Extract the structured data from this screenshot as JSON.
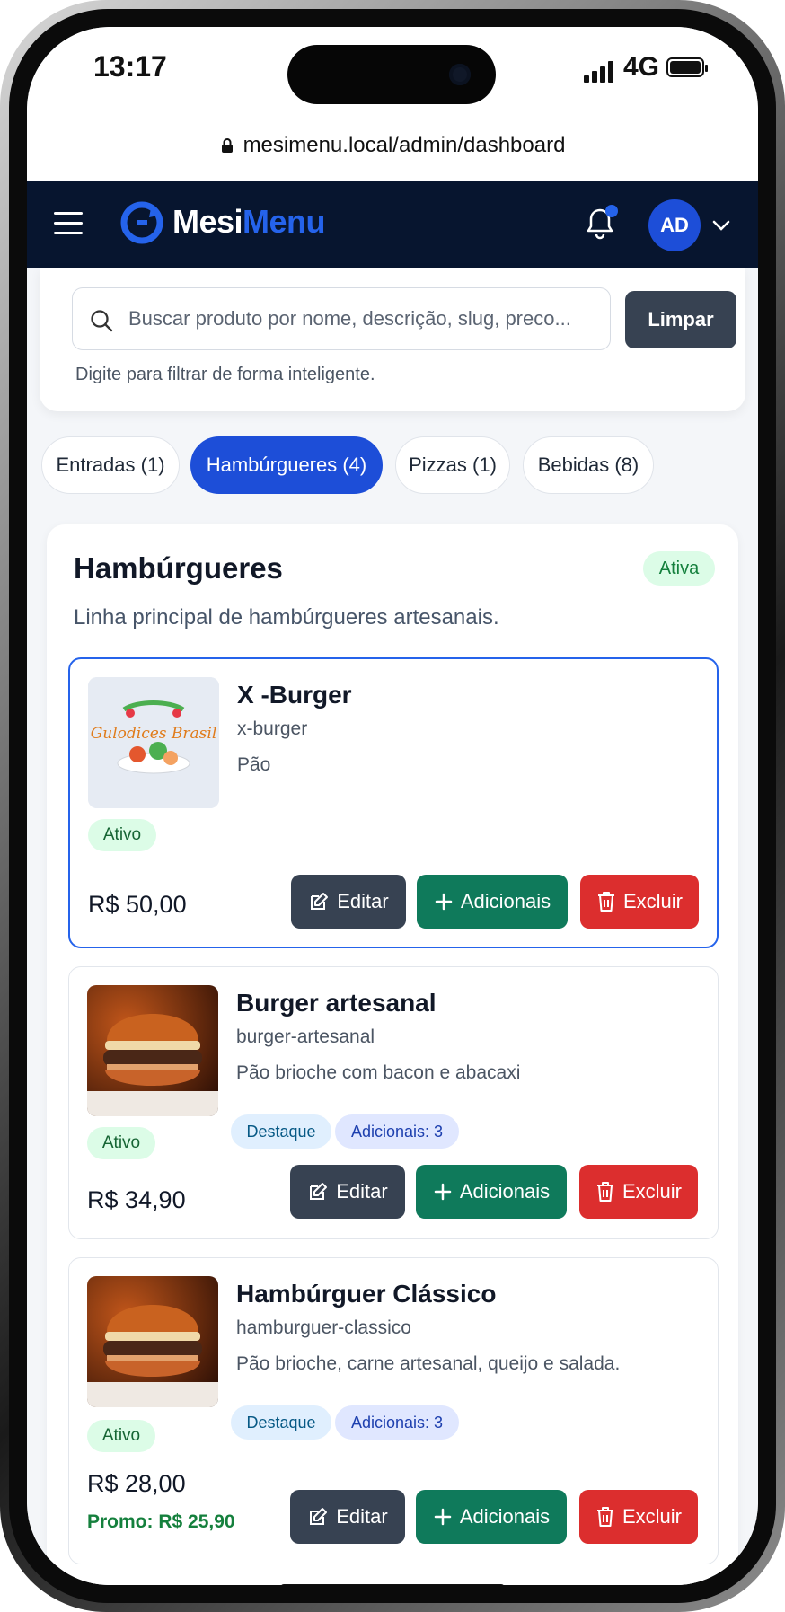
{
  "status_bar": {
    "time": "13:17",
    "network": "4G"
  },
  "browser": {
    "url": "mesimenu.local/admin/dashboard"
  },
  "navbar": {
    "brand_part1": "Mesi",
    "brand_part2": "Menu",
    "avatar_initials": "AD"
  },
  "search": {
    "placeholder": "Buscar produto por nome, descrição, slug, preco...",
    "value": "",
    "clear_label": "Limpar",
    "hint": "Digite para filtrar de forma inteligente."
  },
  "categories": [
    {
      "label": "Entradas (1)",
      "active": false
    },
    {
      "label": "Hambúrgueres (4)",
      "active": true
    },
    {
      "label": "Pizzas (1)",
      "active": false
    },
    {
      "label": "Bebidas (8)",
      "active": false
    }
  ],
  "category": {
    "title": "Hambúrgueres",
    "status": "Ativa",
    "description": "Linha principal de hambúrgueres artesanais."
  },
  "actions": {
    "edit": "Editar",
    "addons": "Adicionais",
    "delete": "Excluir"
  },
  "products": [
    {
      "name": "X -Burger",
      "slug": "x-burger",
      "description": "Pão",
      "status": "Ativo",
      "price": "R$ 50,00",
      "logo_text": "Gulodices Brasil"
    },
    {
      "name": "Burger artesanal",
      "slug": "burger-artesanal",
      "description": "Pão brioche com bacon e abacaxi",
      "status": "Ativo",
      "price": "R$ 34,90",
      "highlight": "Destaque",
      "addons_count": "Adicionais: 3"
    },
    {
      "name": "Hambúrguer Clássico",
      "slug": "hamburguer-classico",
      "description": "Pão brioche, carne artesanal, queijo e salada.",
      "status": "Ativo",
      "price": "R$ 28,00",
      "promo": "Promo: R$ 25,90",
      "highlight": "Destaque",
      "addons_count": "Adicionais: 3"
    }
  ],
  "colors": {
    "nav_bg": "#07152f",
    "primary": "#1d4ed8",
    "edit": "#374252",
    "addons": "#0f7a5b",
    "delete": "#dc2e2e",
    "active_bg": "#dcfce7"
  }
}
